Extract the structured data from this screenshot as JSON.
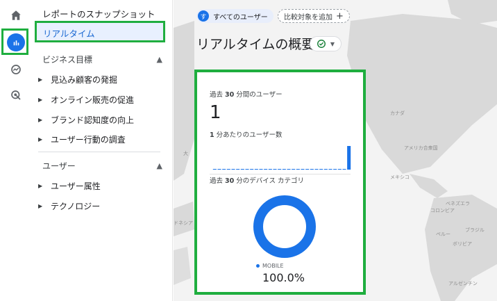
{
  "rail": {
    "items": [
      {
        "name": "home-icon"
      },
      {
        "name": "reports-icon",
        "active": true
      },
      {
        "name": "explore-icon"
      },
      {
        "name": "advertising-icon"
      }
    ]
  },
  "sidebar": {
    "snapshot": "レポートのスナップショット",
    "realtime": "リアルタイム",
    "business_section": "ビジネス目標",
    "business_items": [
      "見込み顧客の発掘",
      "オンライン販売の促進",
      "ブランド認知度の向上",
      "ユーザー行動の調査"
    ],
    "user_section": "ユーザー",
    "user_items": [
      "ユーザー属性",
      "テクノロジー"
    ]
  },
  "topbar": {
    "all_users_badge": "す",
    "all_users": "すべてのユーザー",
    "compare": "比較対象を追加"
  },
  "page": {
    "title": "リアルタイムの概要"
  },
  "card": {
    "users_label_prefix": "過去 ",
    "users_label_num": "30",
    "users_label_suffix": " 分間のユーザー",
    "users_value": "1",
    "per_min_num": "1",
    "per_min_suffix": " 分あたりのユーザー数",
    "device_prefix": "過去 ",
    "device_num": "30",
    "device_suffix": " 分のデバイス カテゴリ",
    "legend_label": "MOBILE",
    "legend_value": "100.0%"
  },
  "map_labels": {
    "canada": "カナダ",
    "usa": "アメリカ合衆国",
    "mexico": "メキシコ",
    "venezuela": "ベネズエラ",
    "colombia": "コロンビア",
    "peru": "ペルー",
    "brazil": "ブラジル",
    "bolivia": "ボリビア",
    "argentina": "アルゼンチン",
    "indonesia": "ドネシア",
    "australia": "大"
  },
  "chart_data": {
    "type": "bar",
    "bars_per_minute": [
      0,
      0,
      0,
      0,
      0,
      0,
      0,
      0,
      0,
      0,
      0,
      0,
      0,
      0,
      0,
      0,
      0,
      0,
      0,
      0,
      0,
      0,
      0,
      0,
      0,
      0,
      0,
      0,
      0,
      1
    ],
    "device_categories": [
      {
        "name": "MOBILE",
        "value": 100.0
      }
    ],
    "colors": {
      "primary": "#1a73e8"
    }
  },
  "colors": {
    "accent": "#1a73e8",
    "highlight": "#1fae3f"
  }
}
